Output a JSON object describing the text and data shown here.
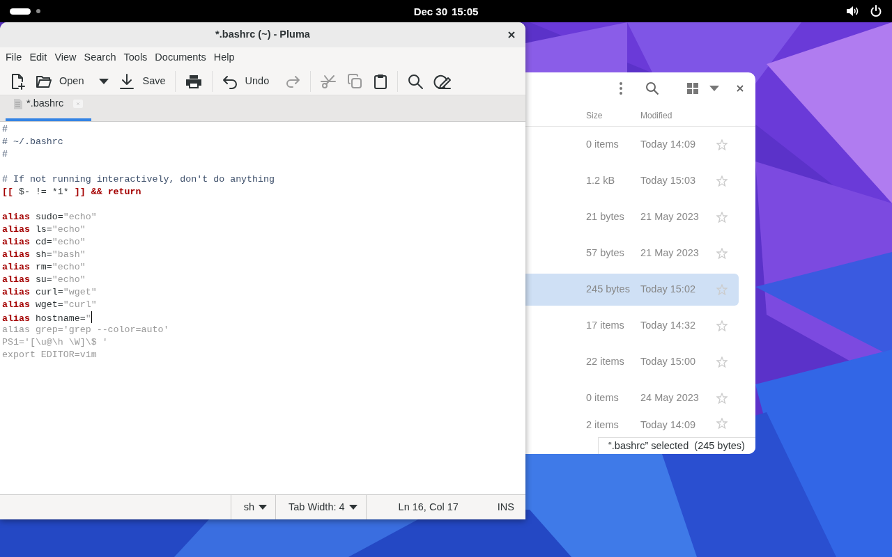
{
  "top_bar": {
    "date": "Dec 30",
    "time": "15:05"
  },
  "editor_window": {
    "title": "*.bashrc (~) - Pluma",
    "menu": [
      "File",
      "Edit",
      "View",
      "Search",
      "Tools",
      "Documents",
      "Help"
    ],
    "toolbar": [
      {
        "kind": "new",
        "disabled": false
      },
      {
        "kind": "open",
        "label": "Open",
        "disabled": false
      },
      {
        "kind": "dropdown",
        "disabled": false
      },
      {
        "kind": "save",
        "label": "Save",
        "disabled": false
      },
      {
        "kind": "separator"
      },
      {
        "kind": "print",
        "disabled": false
      },
      {
        "kind": "separator"
      },
      {
        "kind": "undo",
        "label": "Undo",
        "disabled": false
      },
      {
        "kind": "redo",
        "disabled": true
      },
      {
        "kind": "separator"
      },
      {
        "kind": "cut",
        "disabled": true
      },
      {
        "kind": "copy",
        "disabled": true
      },
      {
        "kind": "paste",
        "disabled": false
      },
      {
        "kind": "separator"
      },
      {
        "kind": "search",
        "disabled": false
      },
      {
        "kind": "replace",
        "disabled": false
      }
    ],
    "tabs": [
      {
        "label": "*.bashrc",
        "selected": true
      }
    ],
    "lines": [
      {
        "kind": "code",
        "segments": [
          {
            "text": "#",
            "kind": "comment"
          }
        ]
      },
      {
        "kind": "code",
        "segments": [
          {
            "text": "# ~/.bashrc",
            "kind": "comment"
          }
        ]
      },
      {
        "kind": "code",
        "segments": [
          {
            "text": "#",
            "kind": "comment"
          }
        ]
      },
      {
        "kind": "blank"
      },
      {
        "kind": "code",
        "segments": [
          {
            "text": "# If not running interactively, don't do anything",
            "kind": "comment"
          }
        ]
      },
      {
        "kind": "code",
        "segments": [
          {
            "text": "[[",
            "kind": "keyword"
          },
          {
            "text": " $- != *i* ",
            "kind": "plain"
          },
          {
            "text": "]] && return",
            "kind": "keyword"
          }
        ]
      },
      {
        "kind": "blank"
      },
      {
        "kind": "code",
        "segments": [
          {
            "text": "alias",
            "kind": "keyword"
          },
          {
            "text": " sudo=",
            "kind": "plain"
          },
          {
            "text": "\"echo\"",
            "kind": "string"
          }
        ]
      },
      {
        "kind": "code",
        "segments": [
          {
            "text": "alias",
            "kind": "keyword"
          },
          {
            "text": " ls=",
            "kind": "plain"
          },
          {
            "text": "\"echo\"",
            "kind": "string"
          }
        ]
      },
      {
        "kind": "code",
        "segments": [
          {
            "text": "alias",
            "kind": "keyword"
          },
          {
            "text": " cd=",
            "kind": "plain"
          },
          {
            "text": "\"echo\"",
            "kind": "string"
          }
        ]
      },
      {
        "kind": "code",
        "segments": [
          {
            "text": "alias",
            "kind": "keyword"
          },
          {
            "text": " sh=",
            "kind": "plain"
          },
          {
            "text": "\"bash\"",
            "kind": "string"
          }
        ]
      },
      {
        "kind": "code",
        "segments": [
          {
            "text": "alias",
            "kind": "keyword"
          },
          {
            "text": " rm=",
            "kind": "plain"
          },
          {
            "text": "\"echo\"",
            "kind": "string"
          }
        ]
      },
      {
        "kind": "code",
        "segments": [
          {
            "text": "alias",
            "kind": "keyword"
          },
          {
            "text": " su=",
            "kind": "plain"
          },
          {
            "text": "\"echo\"",
            "kind": "string"
          }
        ]
      },
      {
        "kind": "code",
        "segments": [
          {
            "text": "alias",
            "kind": "keyword"
          },
          {
            "text": " curl=",
            "kind": "plain"
          },
          {
            "text": "\"wget\"",
            "kind": "string"
          }
        ]
      },
      {
        "kind": "code",
        "segments": [
          {
            "text": "alias",
            "kind": "keyword"
          },
          {
            "text": " wget=",
            "kind": "plain"
          },
          {
            "text": "\"curl\"",
            "kind": "string"
          }
        ]
      },
      {
        "kind": "code",
        "segments": [
          {
            "text": "alias",
            "kind": "keyword"
          },
          {
            "text": " hostname=",
            "kind": "plain"
          },
          {
            "text": "\"",
            "kind": "string"
          },
          {
            "kind": "cursor"
          }
        ]
      },
      {
        "kind": "code",
        "segments": [
          {
            "text": "alias grep='grep --color=auto'",
            "kind": "string"
          }
        ]
      },
      {
        "kind": "code",
        "segments": [
          {
            "text": "PS1='[\\u@\\h \\W]\\$ '",
            "kind": "string"
          }
        ]
      },
      {
        "kind": "code",
        "segments": [
          {
            "text": "export EDITOR=vim",
            "kind": "string"
          }
        ]
      }
    ],
    "status_bar": {
      "language": "sh",
      "tab_width": "Tab Width:  4",
      "position": "Ln 16, Col 17",
      "mode": "INS"
    }
  },
  "file_window": {
    "columns": [
      "Size",
      "Modified"
    ],
    "rows": [
      {
        "size": "0 items",
        "modified": "Today 14:09",
        "starred": false,
        "selected": false
      },
      {
        "size": "1.2 kB",
        "modified": "Today 15:03",
        "starred": false,
        "selected": false
      },
      {
        "size": "21 bytes",
        "modified": "21 May 2023",
        "starred": false,
        "selected": false
      },
      {
        "size": "57 bytes",
        "modified": "21 May 2023",
        "starred": false,
        "selected": false
      },
      {
        "size": "245 bytes",
        "modified": "Today 15:02",
        "starred": false,
        "selected": true
      },
      {
        "size": "17 items",
        "modified": "Today 14:32",
        "starred": false,
        "selected": false
      },
      {
        "size": "22 items",
        "modified": "Today 15:00",
        "starred": false,
        "selected": false
      },
      {
        "size": "0 items",
        "modified": "24 May 2023",
        "starred": false,
        "selected": false
      },
      {
        "size": "2 items",
        "modified": "Today 14:09",
        "starred": false,
        "selected": false
      }
    ],
    "selection_status": "“.bashrc” selected  (245 bytes)"
  }
}
